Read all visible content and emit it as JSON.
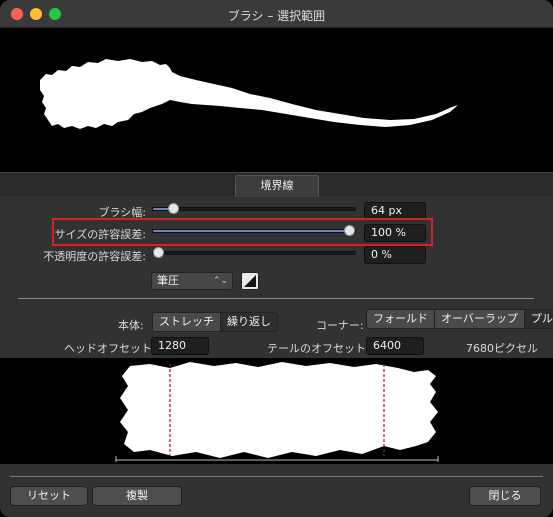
{
  "window": {
    "title": "ブラシ – 選択範囲"
  },
  "tabs": [
    {
      "label": "境界線",
      "active": true
    }
  ],
  "controls": {
    "brush_width": {
      "label": "ブラシ幅:",
      "value": "64 px",
      "level": 0.08
    },
    "size_tolerance": {
      "label": "サイズの許容誤差:",
      "value": "100 %",
      "level": 1.0
    },
    "opacity_tolerance": {
      "label": "不透明度の許容誤差:",
      "value": "0 %",
      "level": 0.0
    },
    "controller": {
      "selected": "筆圧",
      "chevron": "⌃⌄"
    }
  },
  "body_mode": {
    "label": "本体:",
    "options": [
      "ストレッチ",
      "繰り返し"
    ],
    "active": "繰り返し"
  },
  "corner_mode": {
    "label": "コーナー:",
    "options": [
      "フォールド",
      "オーバーラップ",
      "プル"
    ],
    "active": "プル"
  },
  "head_offset": {
    "label": "ヘッドオフセット:",
    "value": "1280 px"
  },
  "tail_offset": {
    "label": "テールのオフセット:",
    "value": "6400 px"
  },
  "total_pixels": "7680ピクセル",
  "buttons": {
    "reset": "リセット",
    "duplicate": "複製",
    "close": "閉じる"
  },
  "colors": {
    "accent": "#6a86b8",
    "highlight": "#d42121",
    "panel": "#323232"
  }
}
